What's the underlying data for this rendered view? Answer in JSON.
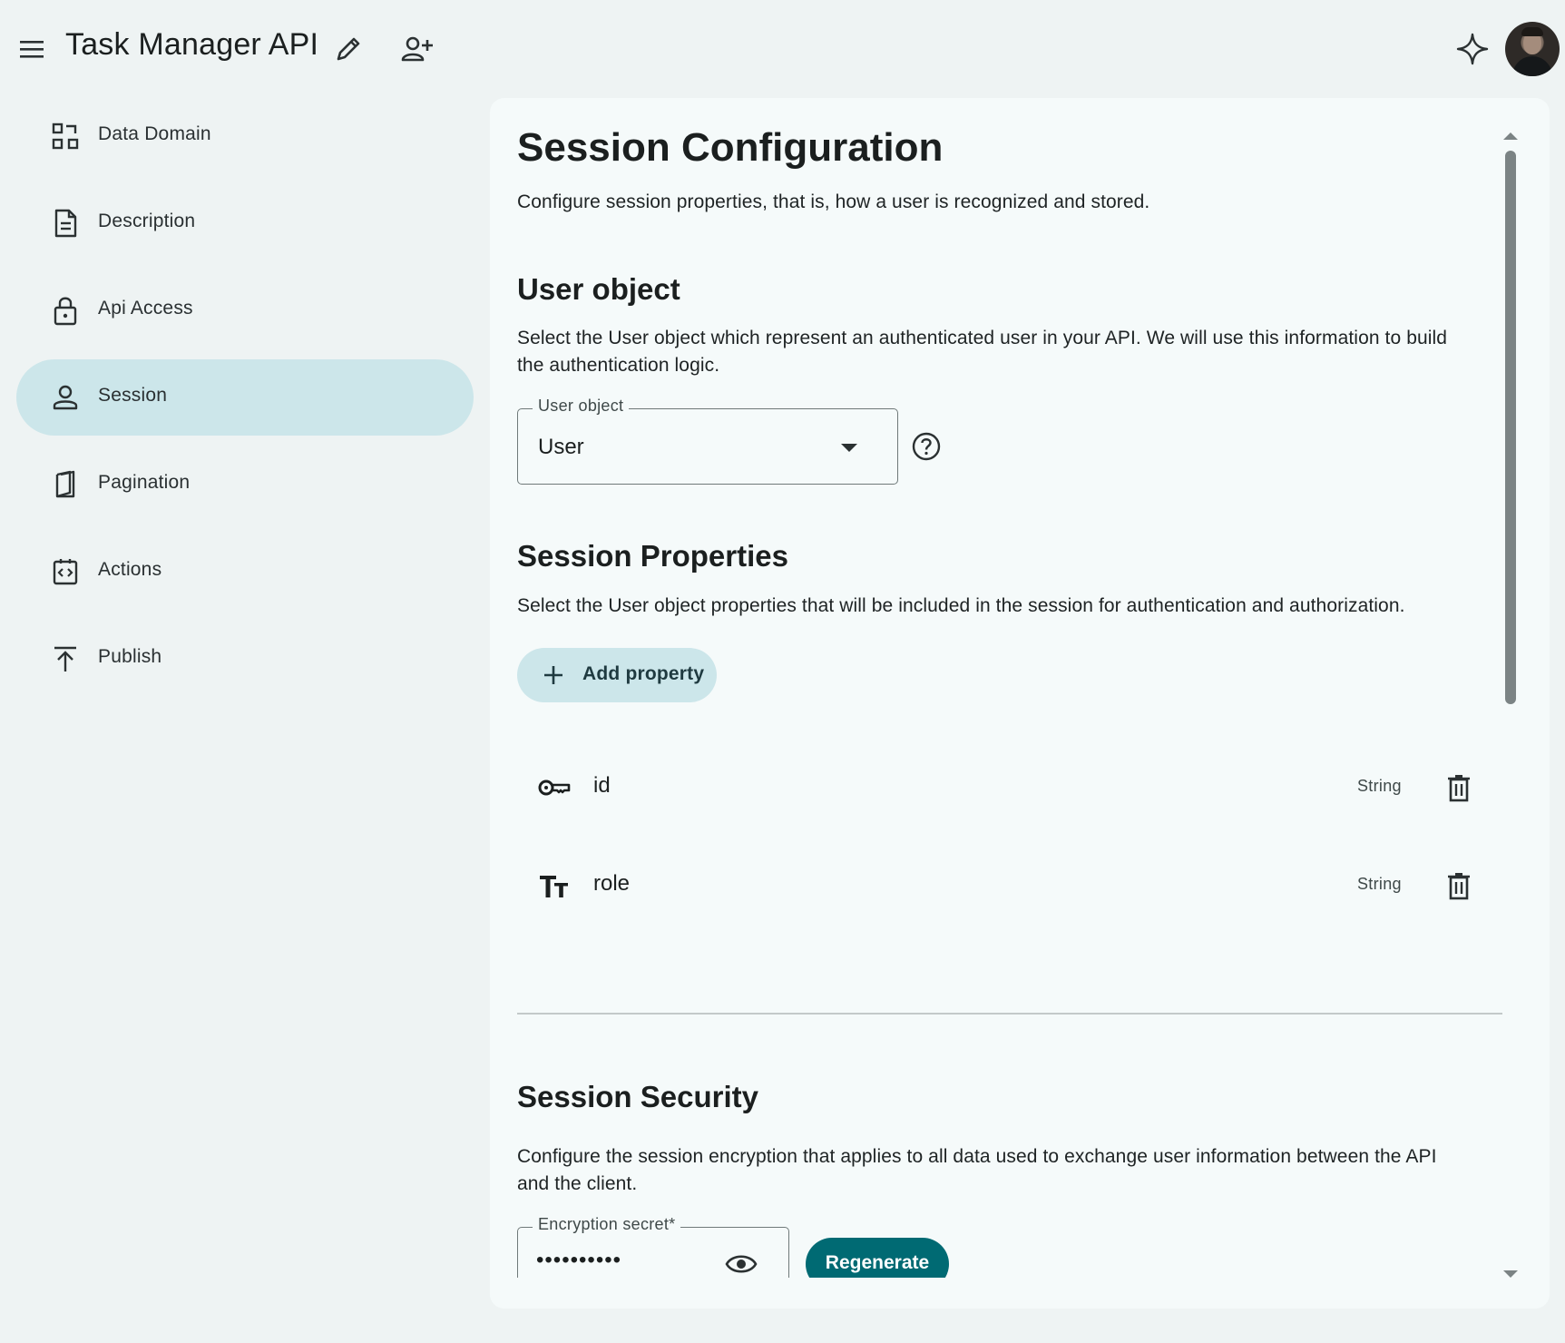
{
  "header": {
    "title": "Task Manager API",
    "icons": {
      "menu": "menu-icon",
      "edit": "pencil-icon",
      "share": "person-add-icon",
      "assistant": "sparkle-icon",
      "avatar": "user-avatar"
    }
  },
  "sidebar": {
    "items": [
      {
        "label": "Data Domain",
        "icon": "data-domain-icon"
      },
      {
        "label": "Description",
        "icon": "document-icon"
      },
      {
        "label": "Api Access",
        "icon": "lock-icon"
      },
      {
        "label": "Session",
        "icon": "person-icon",
        "active": true
      },
      {
        "label": "Pagination",
        "icon": "book-icon"
      },
      {
        "label": "Actions",
        "icon": "code-icon"
      },
      {
        "label": "Publish",
        "icon": "upload-icon"
      }
    ]
  },
  "main": {
    "title": "Session Configuration",
    "subtitle": "Configure session properties, that is, how a user is recognized and stored.",
    "user_object": {
      "heading": "User object",
      "description_line1": "Select the User object which represent an authenticated user in your API. We will use this information to build",
      "description_line2": "the authentication logic.",
      "field_label": "User object",
      "field_value": "User"
    },
    "session_properties": {
      "heading": "Session Properties",
      "description": "Select the User object properties that will be included in the session for authentication and authorization.",
      "add_button_label": "Add property",
      "properties": [
        {
          "name": "id",
          "type": "String",
          "icon": "key-icon"
        },
        {
          "name": "role",
          "type": "String",
          "icon": "text-type-icon"
        }
      ]
    },
    "session_security": {
      "heading": "Session Security",
      "description_line1": "Configure the session encryption that applies to all data used to exchange user information between the API",
      "description_line2": "and the client.",
      "secret_label": "Encryption secret*",
      "secret_value": "••••••••••",
      "regenerate_label": "Regenerate"
    }
  },
  "colors": {
    "accent": "#006a73",
    "active_nav": "#cce6ea",
    "background": "#eef3f3",
    "panel": "#f5fafa"
  }
}
